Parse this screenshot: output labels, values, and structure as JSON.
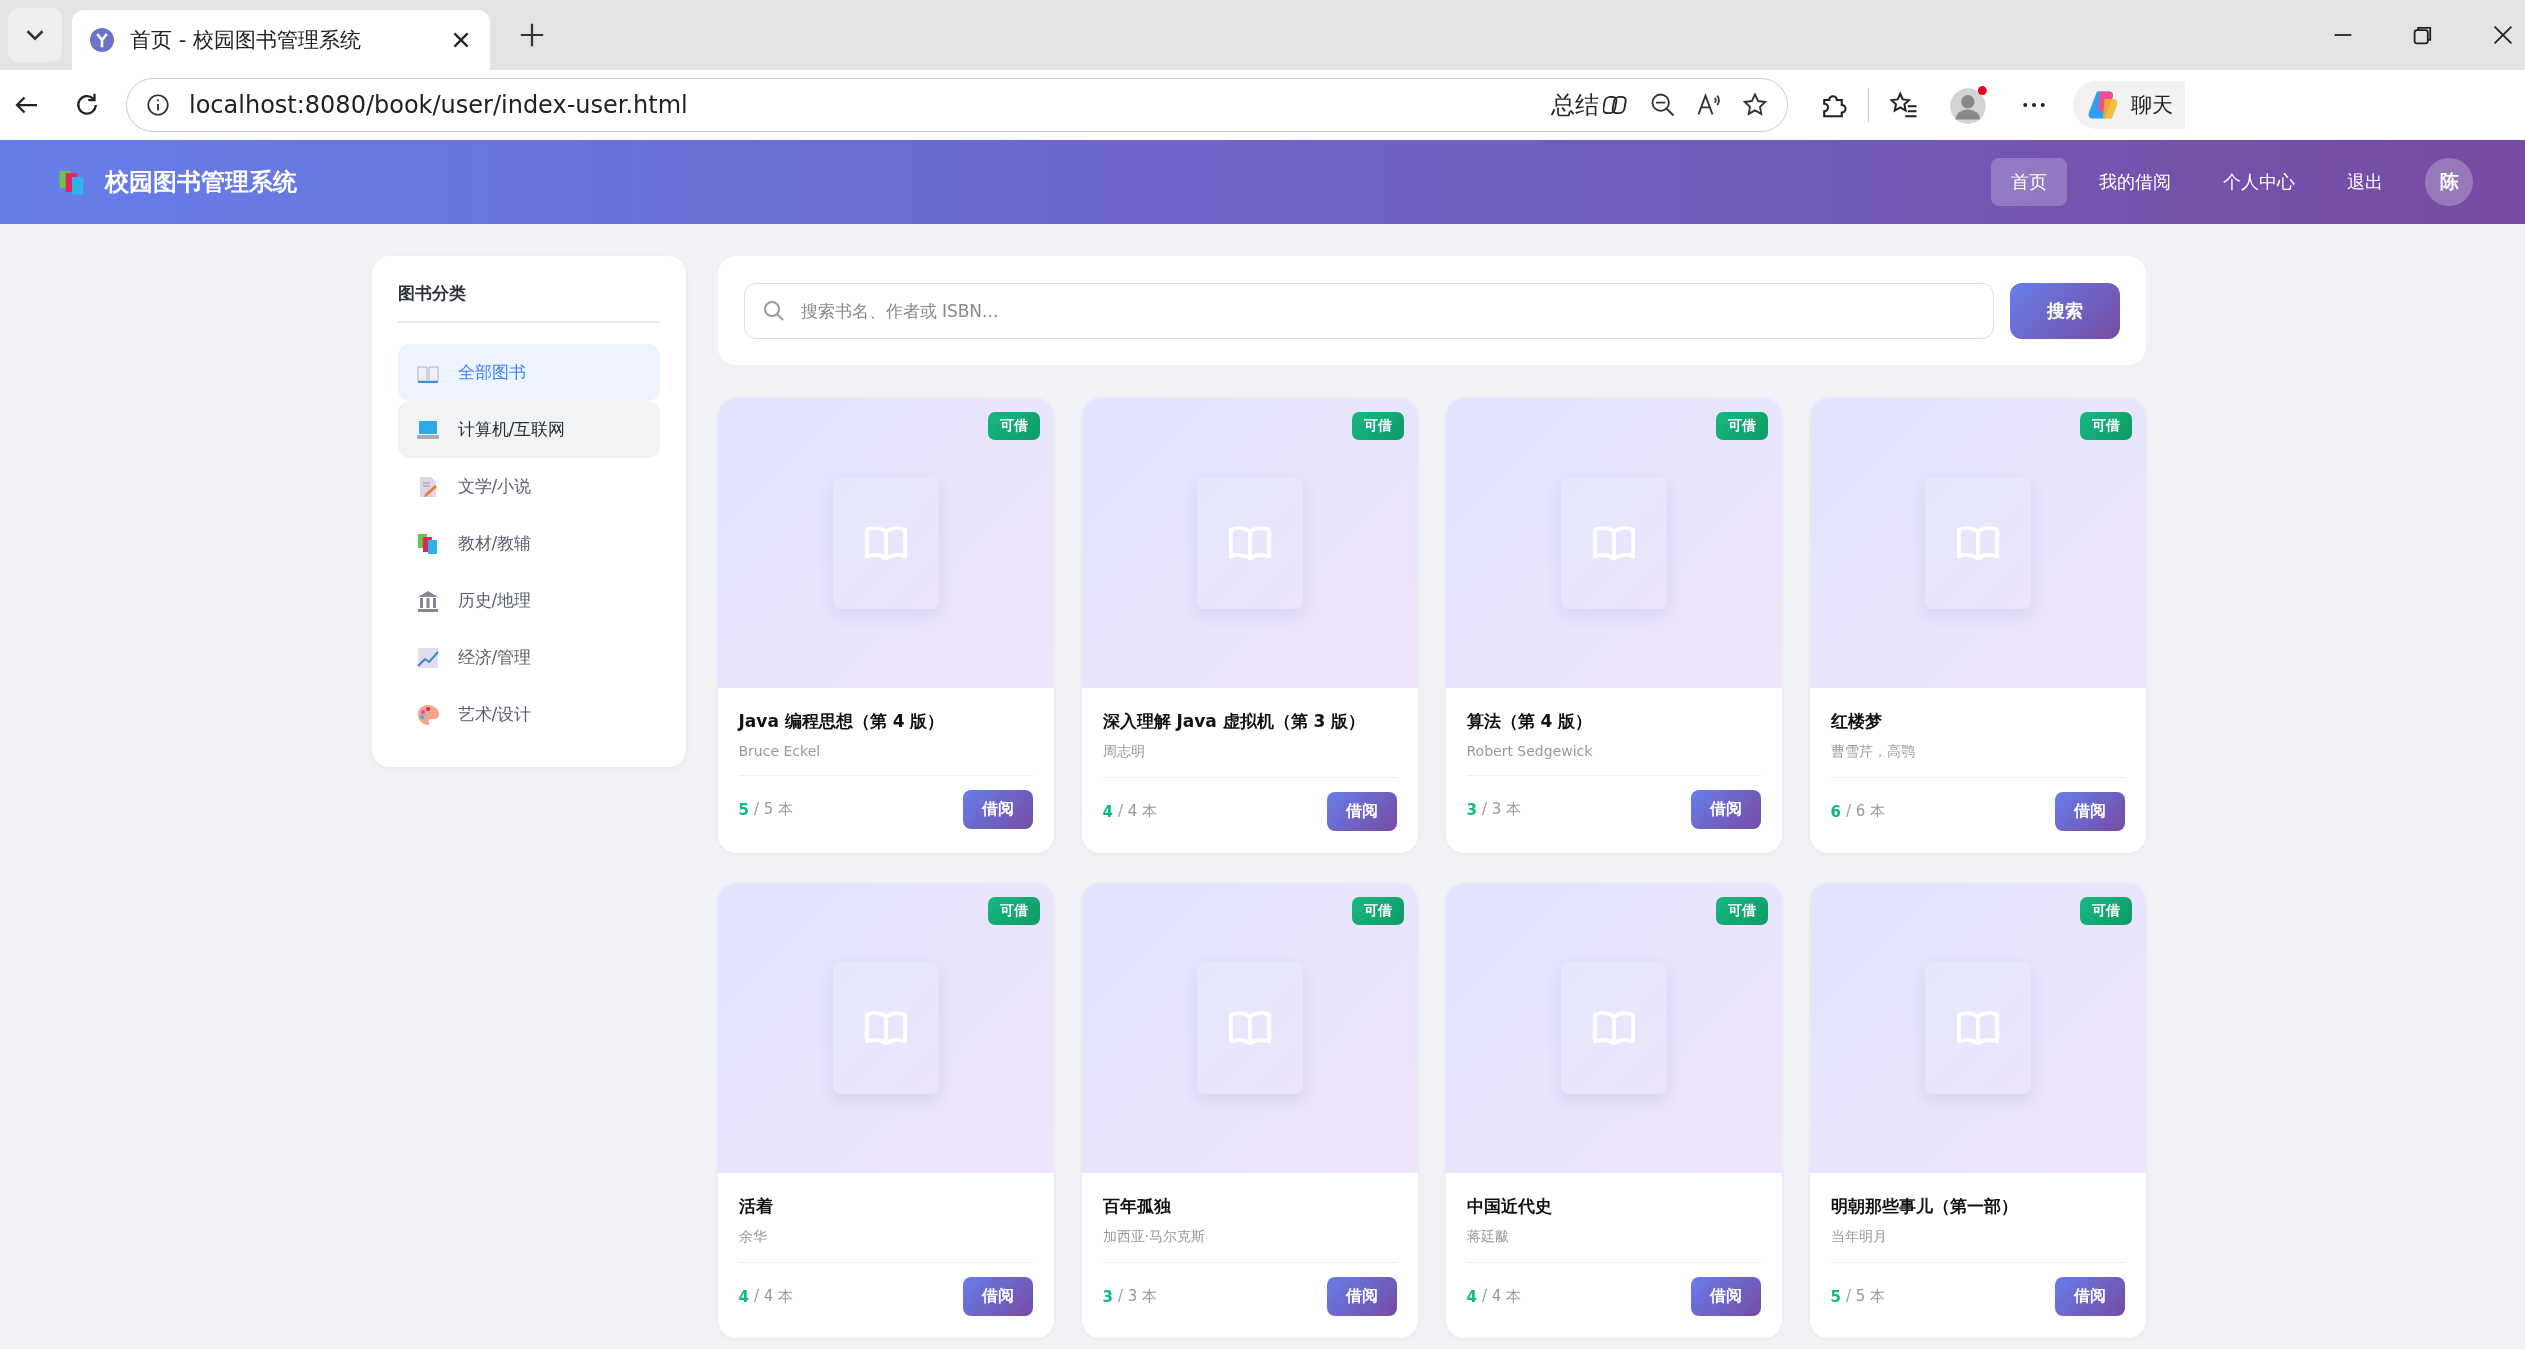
{
  "browser": {
    "tab_title": "首页 - 校园图书管理系统",
    "url": "localhost:8080/book/user/index-user.html",
    "summarize": "总结",
    "chat": "聊天"
  },
  "header": {
    "title": "校园图书管理系统",
    "nav": [
      {
        "label": "首页",
        "selected": true
      },
      {
        "label": "我的借阅",
        "selected": false
      },
      {
        "label": "个人中心",
        "selected": false
      },
      {
        "label": "退出",
        "selected": false
      }
    ],
    "avatar": "陈"
  },
  "sidebar": {
    "title": "图书分类",
    "categories": [
      {
        "label": "全部图书",
        "kind": "book",
        "selected": true,
        "hovered": false
      },
      {
        "label": "计算机/互联网",
        "kind": "laptop",
        "selected": false,
        "hovered": true
      },
      {
        "label": "文学/小说",
        "kind": "memo",
        "selected": false,
        "hovered": false
      },
      {
        "label": "教材/教辅",
        "kind": "books",
        "selected": false,
        "hovered": false
      },
      {
        "label": "历史/地理",
        "kind": "building",
        "selected": false,
        "hovered": false
      },
      {
        "label": "经济/管理",
        "kind": "chart",
        "selected": false,
        "hovered": false
      },
      {
        "label": "艺术/设计",
        "kind": "palette",
        "selected": false,
        "hovered": false
      }
    ]
  },
  "search": {
    "placeholder": "搜索书名、作者或 ISBN...",
    "button": "搜索"
  },
  "books": [
    {
      "badge": "可借",
      "title": "Java 编程思想（第 4 版）",
      "author": "Bruce Eckel",
      "available": "5",
      "total": "/ 5 本",
      "button": "借阅"
    },
    {
      "badge": "可借",
      "title": "深入理解 Java 虚拟机（第 3 版）",
      "author": "周志明",
      "available": "4",
      "total": "/ 4 本",
      "button": "借阅"
    },
    {
      "badge": "可借",
      "title": "算法（第 4 版）",
      "author": "Robert Sedgewick",
      "available": "3",
      "total": "/ 3 本",
      "button": "借阅"
    },
    {
      "badge": "可借",
      "title": "红楼梦",
      "author": "曹雪芹，高鹗",
      "available": "6",
      "total": "/ 6 本",
      "button": "借阅"
    },
    {
      "badge": "可借",
      "title": "活着",
      "author": "余华",
      "available": "4",
      "total": "/ 4 本",
      "button": "借阅"
    },
    {
      "badge": "可借",
      "title": "百年孤独",
      "author": "加西亚·马尔克斯",
      "available": "3",
      "total": "/ 3 本",
      "button": "借阅"
    },
    {
      "badge": "可借",
      "title": "中国近代史",
      "author": "蒋廷黻",
      "available": "4",
      "total": "/ 4 本",
      "button": "借阅"
    },
    {
      "badge": "可借",
      "title": "明朝那些事儿（第一部）",
      "author": "当年明月",
      "available": "5",
      "total": "/ 5 本",
      "button": "借阅"
    }
  ]
}
